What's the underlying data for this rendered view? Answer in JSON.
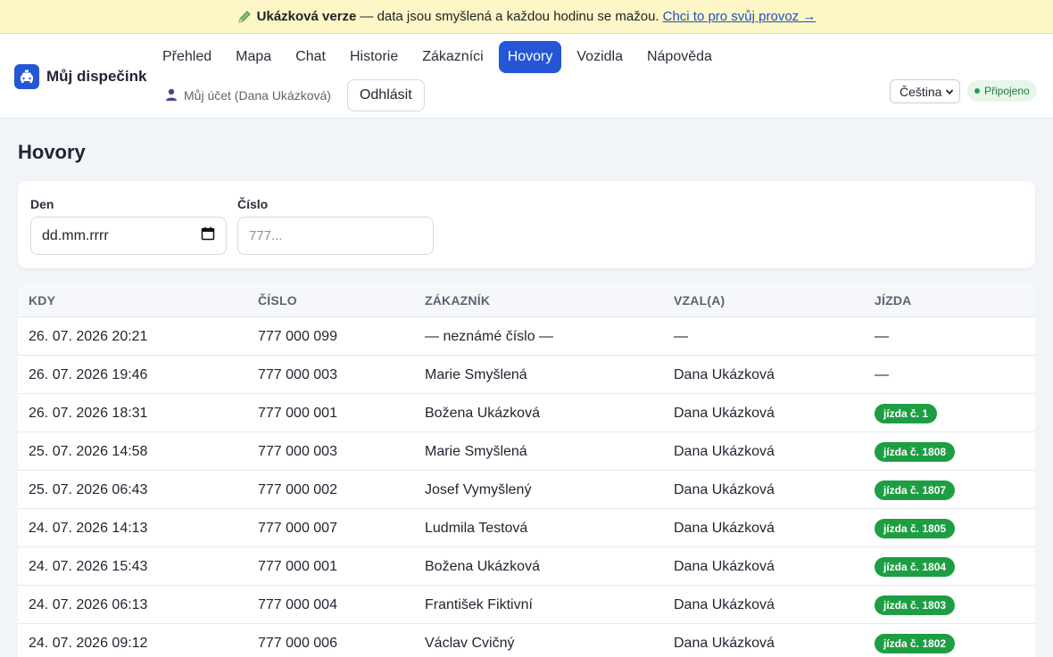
{
  "banner": {
    "title": "Ukázková verze",
    "text": "— data jsou smyšlená a každou hodinu se mažou.",
    "link": "Chci to pro svůj provoz →"
  },
  "brand": {
    "name": "Můj dispečink",
    "accent": "#2456d6"
  },
  "nav": {
    "items": [
      {
        "label": "Přehled"
      },
      {
        "label": "Mapa"
      },
      {
        "label": "Chat"
      },
      {
        "label": "Historie"
      },
      {
        "label": "Zákazníci"
      },
      {
        "label": "Hovory",
        "active": true
      },
      {
        "label": "Vozidla"
      },
      {
        "label": "Nápověda"
      }
    ],
    "account": "Můj účet (Dana Ukázková)",
    "logout": "Odhlásit"
  },
  "language": {
    "selected": "Čeština"
  },
  "status": {
    "label": "Připojeno",
    "color": "#22a04a"
  },
  "page": {
    "title": "Hovory"
  },
  "filters": {
    "day_label": "Den",
    "day_placeholder": "dd.mm.rrrr",
    "number_label": "Číslo",
    "number_placeholder": "777..."
  },
  "table": {
    "headers": [
      "KDY",
      "ČÍSLO",
      "ZÁKAZNÍK",
      "VZAL(A)",
      "JÍZDA"
    ],
    "rows": [
      {
        "when": "26. 07. 2026 20:21",
        "number": "777 000 099",
        "customer": "— neznámé číslo —",
        "taken_by": "—",
        "ride": "—",
        "ride_badge": false
      },
      {
        "when": "26. 07. 2026 19:46",
        "number": "777 000 003",
        "customer": "Marie Smyšlená",
        "taken_by": "Dana Ukázková",
        "ride": "—",
        "ride_badge": false
      },
      {
        "when": "26. 07. 2026 18:31",
        "number": "777 000 001",
        "customer": "Božena Ukázková",
        "taken_by": "Dana Ukázková",
        "ride": "jízda č. 1",
        "ride_badge": true
      },
      {
        "when": "25. 07. 2026 14:58",
        "number": "777 000 003",
        "customer": "Marie Smyšlená",
        "taken_by": "Dana Ukázková",
        "ride": "jízda č. 1808",
        "ride_badge": true
      },
      {
        "when": "25. 07. 2026 06:43",
        "number": "777 000 002",
        "customer": "Josef Vymyšlený",
        "taken_by": "Dana Ukázková",
        "ride": "jízda č. 1807",
        "ride_badge": true
      },
      {
        "when": "24. 07. 2026 14:13",
        "number": "777 000 007",
        "customer": "Ludmila Testová",
        "taken_by": "Dana Ukázková",
        "ride": "jízda č. 1805",
        "ride_badge": true
      },
      {
        "when": "24. 07. 2026 15:43",
        "number": "777 000 001",
        "customer": "Božena Ukázková",
        "taken_by": "Dana Ukázková",
        "ride": "jízda č. 1804",
        "ride_badge": true
      },
      {
        "when": "24. 07. 2026 06:13",
        "number": "777 000 004",
        "customer": "František Fiktivní",
        "taken_by": "Dana Ukázková",
        "ride": "jízda č. 1803",
        "ride_badge": true
      },
      {
        "when": "24. 07. 2026 09:12",
        "number": "777 000 006",
        "customer": "Václav Cvičný",
        "taken_by": "Dana Ukázková",
        "ride": "jízda č. 1802",
        "ride_badge": true
      }
    ]
  }
}
